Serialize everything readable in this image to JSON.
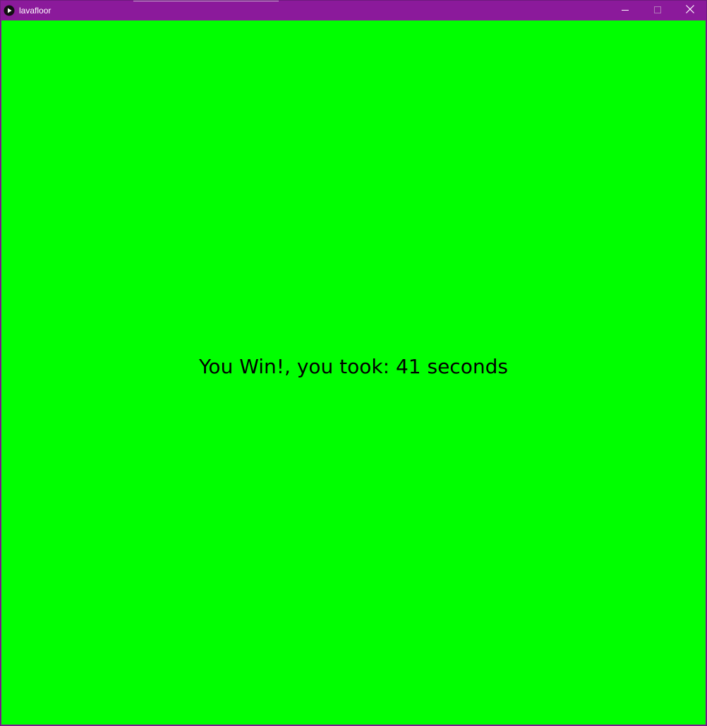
{
  "window": {
    "title": "lavafloor",
    "title_bar_color": "#8b1a9b",
    "icons": {
      "app": "play-icon",
      "minimize": "minimize-icon",
      "maximize": "maximize-icon",
      "close": "close-icon"
    }
  },
  "game": {
    "background_color": "#00ff00",
    "message": "You Win!, you took: 41 seconds"
  }
}
